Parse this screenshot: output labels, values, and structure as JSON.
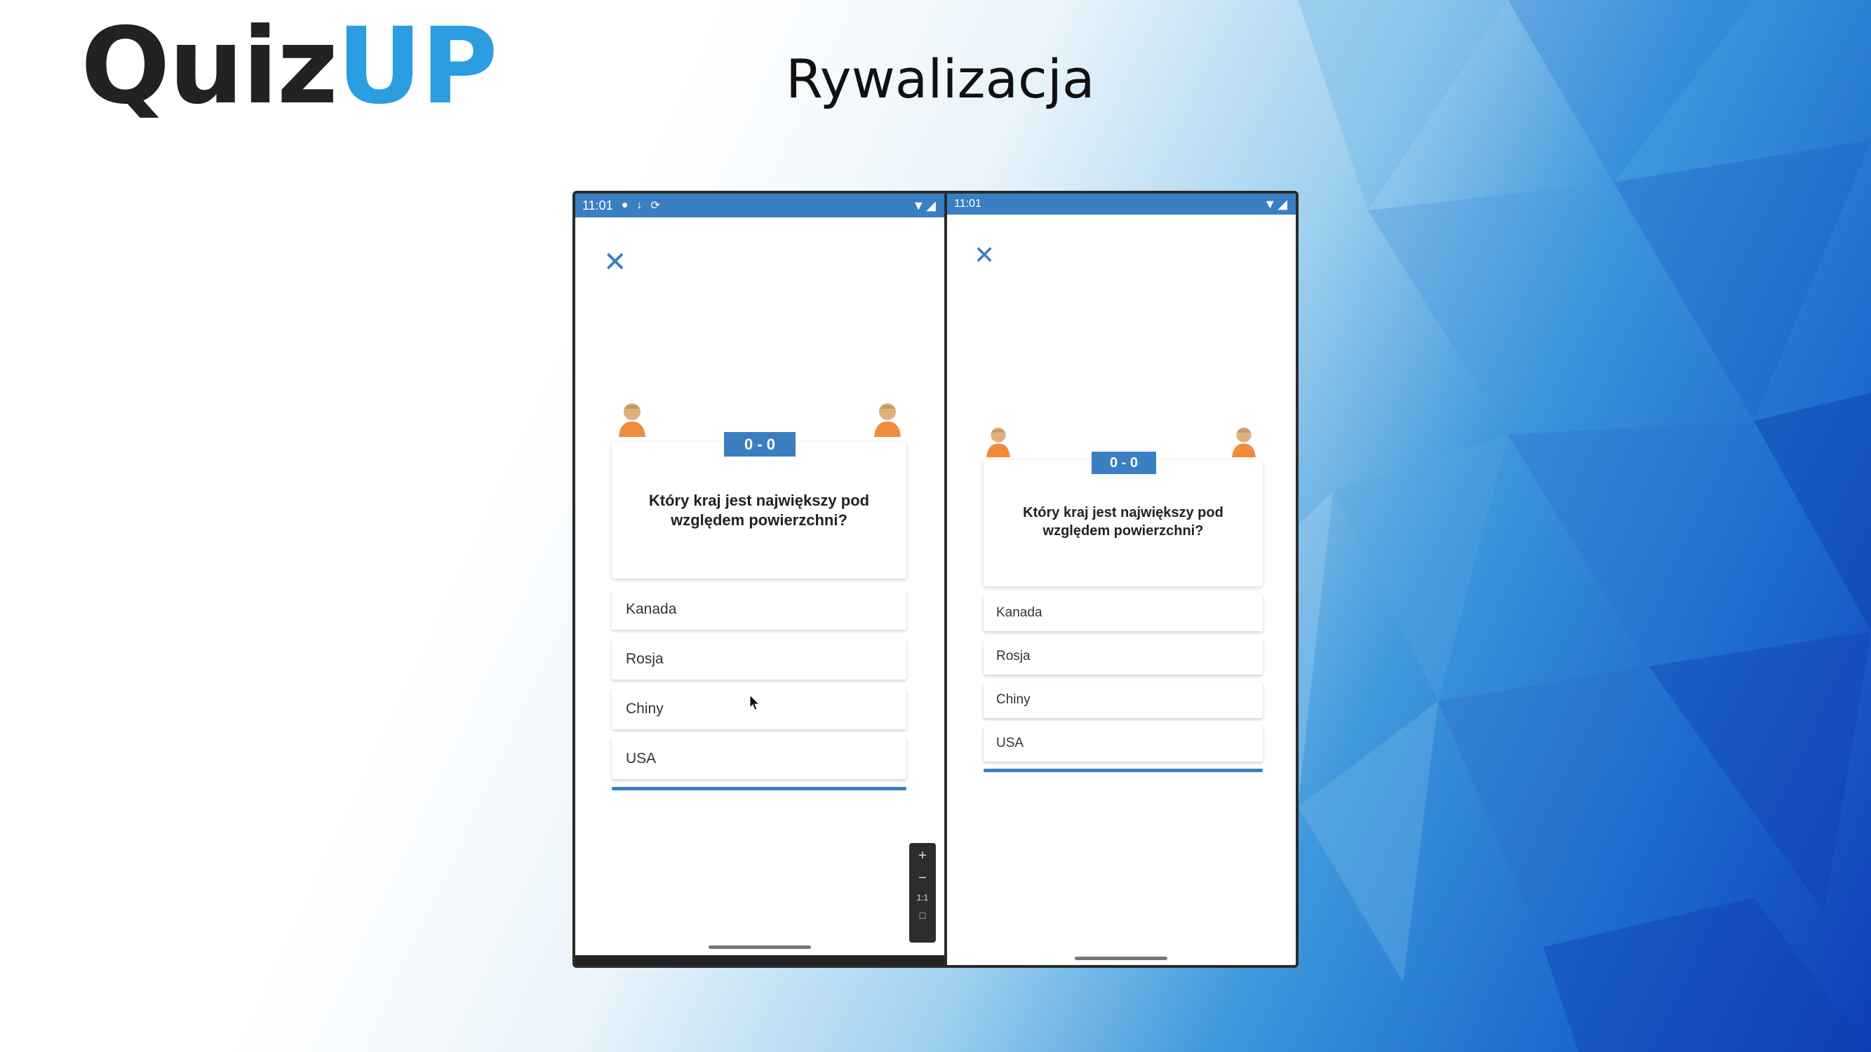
{
  "slide": {
    "logo_part1": "Quiz",
    "logo_part2": "UP",
    "heading": "Rywalizacja",
    "colors": {
      "accent": "#3a7fc1",
      "logo_blue": "#2a9ee0",
      "logo_dark": "#222222"
    }
  },
  "left_phone": {
    "status_time": "11:01",
    "status_icons": [
      "chat-icon",
      "download-icon",
      "sync-icon"
    ],
    "status_right": [
      "wifi-icon",
      "signal-icon"
    ],
    "close_icon": "close-icon",
    "score": "0 - 0",
    "question": "Który kraj jest największy pod względem powierzchni?",
    "answers": [
      "Kanada",
      "Rosja",
      "Chiny",
      "USA"
    ],
    "zoom_controls": [
      "+",
      "−",
      "1:1",
      "□"
    ]
  },
  "right_phone": {
    "status_time": "11:01",
    "status_right": [
      "wifi-icon",
      "signal-icon"
    ],
    "close_icon": "close-icon",
    "score": "0 - 0",
    "question": "Który kraj jest największy pod względem powierzchni?",
    "answers": [
      "Kanada",
      "Rosja",
      "Chiny",
      "USA"
    ]
  }
}
